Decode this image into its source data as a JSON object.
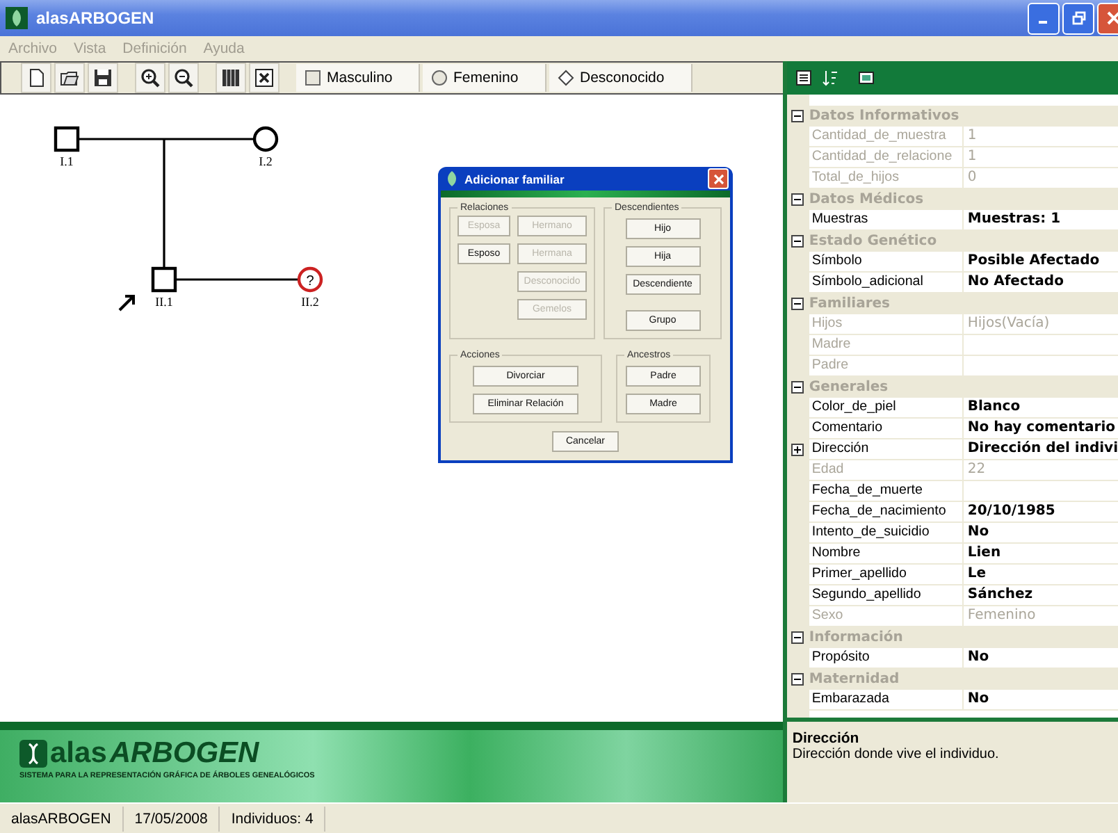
{
  "window": {
    "title": "alasARBOGEN"
  },
  "menu": [
    "Archivo",
    "Vista",
    "Definición",
    "Ayuda"
  ],
  "toolbar": {
    "icons": [
      {
        "kind": "new"
      },
      {
        "kind": "open"
      },
      {
        "kind": "save"
      },
      {
        "kind": "zoom_in"
      },
      {
        "kind": "zoom_out"
      },
      {
        "kind": "columns"
      },
      {
        "kind": "delete"
      }
    ],
    "shapes": [
      {
        "kind": "square",
        "label": "Masculino"
      },
      {
        "kind": "circle",
        "label": "Femenino"
      },
      {
        "kind": "diamond",
        "label": "Desconocido"
      }
    ]
  },
  "pedigree": {
    "individuals": [
      {
        "label": "I.1",
        "kind": "male",
        "color": "#000000",
        "proband": false
      },
      {
        "label": "I.2",
        "kind": "female",
        "color": "#000000",
        "proband": false
      },
      {
        "label": "II.1",
        "kind": "male",
        "color": "#000000",
        "proband": true
      },
      {
        "label": "II.2",
        "kind": "female",
        "color": "#cc2222",
        "mark": "?",
        "proband": false
      }
    ]
  },
  "dialog": {
    "title": "Adicionar familiar",
    "relaciones": {
      "title": "Relaciones",
      "columns": [
        [
          {
            "label": "Esposa",
            "disabled": true
          },
          {
            "label": "Esposo",
            "disabled": false
          }
        ],
        [
          {
            "label": "Hermano",
            "disabled": true
          },
          {
            "label": "Hermana",
            "disabled": true
          },
          {
            "label": "Desconocido",
            "disabled": true
          },
          {
            "label": "Gemelos",
            "disabled": true
          }
        ]
      ]
    },
    "descendientes": {
      "title": "Descendientes",
      "buttons": [
        "Hijo",
        "Hija",
        "Descendiente",
        "Grupo"
      ]
    },
    "acciones": {
      "title": "Acciones",
      "buttons": [
        "Divorciar",
        "Eliminar Relación"
      ]
    },
    "ancestros": {
      "title": "Ancestros",
      "buttons": [
        "Padre",
        "Madre"
      ]
    },
    "cancel": "Cancelar"
  },
  "properties": {
    "categories": [
      {
        "name": "Datos Informativos",
        "expanded": true,
        "rows": [
          {
            "name": "Cantidad_de_muestra",
            "value": "1",
            "disabled": true,
            "expandable": false
          },
          {
            "name": "Cantidad_de_relacione",
            "value": "1",
            "disabled": true,
            "expandable": false
          },
          {
            "name": "Total_de_hijos",
            "value": "0",
            "disabled": true,
            "expandable": false
          }
        ]
      },
      {
        "name": "Datos Médicos",
        "expanded": true,
        "rows": [
          {
            "name": "Muestras",
            "value": "Muestras: 1",
            "disabled": false,
            "expandable": false
          }
        ]
      },
      {
        "name": "Estado Genético",
        "expanded": true,
        "rows": [
          {
            "name": "Símbolo",
            "value": "Posible Afectado",
            "disabled": false,
            "expandable": false
          },
          {
            "name": "Símbolo_adicional",
            "value": "No Afectado",
            "disabled": false,
            "expandable": false
          }
        ]
      },
      {
        "name": "Familiares",
        "expanded": true,
        "rows": [
          {
            "name": "Hijos",
            "value": "Hijos(Vacía)",
            "disabled": true,
            "expandable": false
          },
          {
            "name": "Madre",
            "disabled": true,
            "expandable": false
          },
          {
            "name": "Padre",
            "disabled": true,
            "expandable": false
          }
        ]
      },
      {
        "name": "Generales",
        "expanded": true,
        "rows": [
          {
            "name": "Color_de_piel",
            "value": "Blanco",
            "disabled": false,
            "expandable": false
          },
          {
            "name": "Comentario",
            "value": "No hay comentario",
            "disabled": false,
            "expandable": false
          },
          {
            "name": "Dirección",
            "value": "Dirección del indivi",
            "disabled": false,
            "expandable": true
          },
          {
            "name": "Edad",
            "value": "22",
            "disabled": true,
            "expandable": false
          },
          {
            "name": "Fecha_de_muerte",
            "disabled": false,
            "expandable": false
          },
          {
            "name": "Fecha_de_nacimiento",
            "value": "20/10/1985",
            "disabled": false,
            "expandable": false
          },
          {
            "name": "Intento_de_suicidio",
            "value": "No",
            "disabled": false,
            "expandable": false
          },
          {
            "name": "Nombre",
            "value": "Lien",
            "disabled": false,
            "expandable": false
          },
          {
            "name": "Primer_apellido",
            "value": "Le",
            "disabled": false,
            "expandable": false
          },
          {
            "name": "Segundo_apellido",
            "value": "Sánchez",
            "disabled": false,
            "expandable": false
          },
          {
            "name": "Sexo",
            "value": "Femenino",
            "disabled": true,
            "expandable": false
          }
        ]
      },
      {
        "name": "Información",
        "expanded": true,
        "rows": [
          {
            "name": "Propósito",
            "value": "No",
            "disabled": false,
            "expandable": false
          }
        ]
      },
      {
        "name": "Maternidad",
        "expanded": true,
        "rows": [
          {
            "name": "Embarazada",
            "value": "No",
            "disabled": false,
            "expandable": false
          }
        ]
      }
    ],
    "description": {
      "title": "Dirección",
      "text": "Dirección donde vive el individuo."
    }
  },
  "banner": {
    "logo_prefix": "alas",
    "logo_name": "ARBOGEN",
    "subtitle": "SISTEMA PARA LA REPRESENTACIÓN GRÁFICA DE ÁRBOLES GENEALÓGICOS"
  },
  "status_bar": [
    "alasARBOGEN",
    "17/05/2008",
    "Individuos: 4"
  ]
}
